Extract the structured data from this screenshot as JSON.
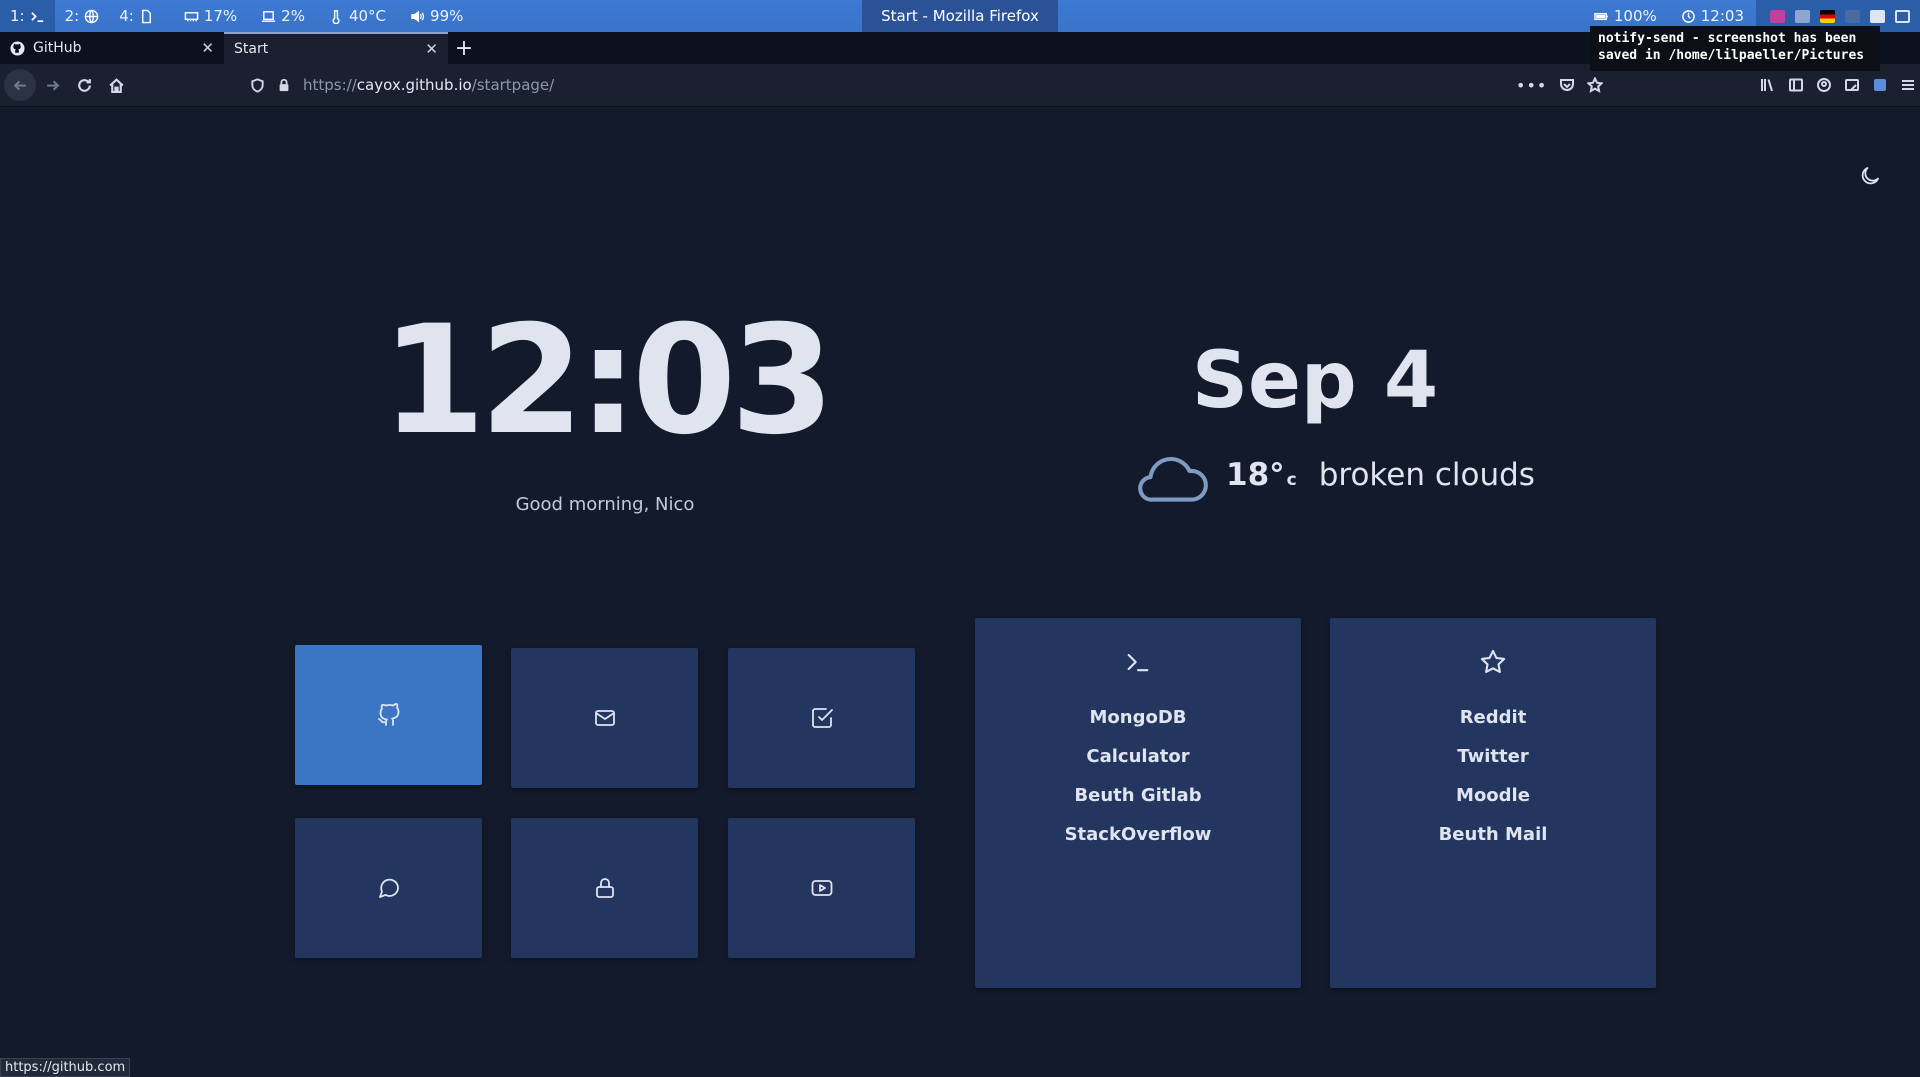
{
  "topbar": {
    "workspaces": [
      {
        "label": "1:",
        "icon": "terminal-icon"
      },
      {
        "label": "2:",
        "icon": "globe-icon"
      },
      {
        "label": "4:",
        "icon": "file-icon"
      }
    ],
    "memory": "17%",
    "cpu": "2%",
    "temperature": "40°C",
    "volume": "99%",
    "window_title": "Start - Mozilla Firefox",
    "battery": "100%",
    "time": "12:03"
  },
  "notification": {
    "text": "notify-send - screenshot has been\nsaved in /home/lilpaeller/Pictures"
  },
  "browser": {
    "tabs": [
      {
        "label": "GitHub",
        "icon": "github-icon",
        "selected": false
      },
      {
        "label": "Start",
        "icon": "",
        "selected": true
      }
    ],
    "url": {
      "scheme": "https://",
      "host": "cayox.github.io",
      "path": "/startpage/"
    },
    "status_url": "https://github.com"
  },
  "startpage": {
    "clock": "12:03",
    "greeting": "Good morning, Nico",
    "date": "Sep 4",
    "weather": {
      "temp": "18°",
      "unit": "c",
      "description": "broken clouds",
      "icon": "cloud-icon"
    },
    "tiles": [
      {
        "name": "github",
        "icon": "github-icon",
        "active": true
      },
      {
        "name": "mail",
        "icon": "mail-icon",
        "active": false
      },
      {
        "name": "tasks",
        "icon": "check-square-icon",
        "active": false
      },
      {
        "name": "chat",
        "icon": "message-circle-icon",
        "active": false
      },
      {
        "name": "passwords",
        "icon": "lock-icon",
        "active": false
      },
      {
        "name": "youtube",
        "icon": "youtube-icon",
        "active": false
      }
    ],
    "cards": [
      {
        "icon": "terminal-icon",
        "links": [
          "MongoDB",
          "Calculator",
          "Beuth Gitlab",
          "StackOverflow"
        ]
      },
      {
        "icon": "star-icon",
        "links": [
          "Reddit",
          "Twitter",
          "Moodle",
          "Beuth Mail"
        ]
      }
    ]
  }
}
